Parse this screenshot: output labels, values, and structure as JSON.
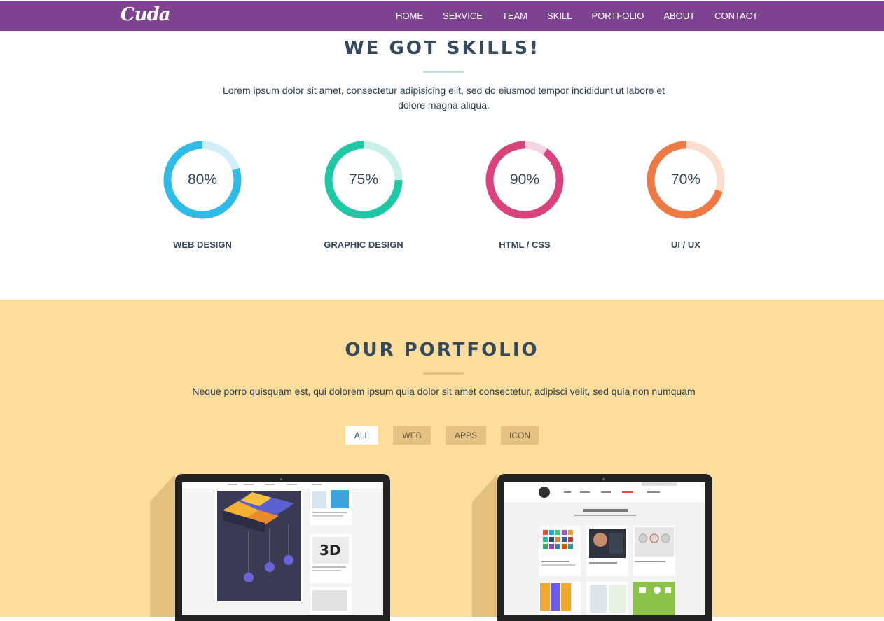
{
  "navbar": {
    "logo": "Cuda",
    "items": [
      "HOME",
      "SERVICE",
      "TEAM",
      "SKILL",
      "PORTFOLIO",
      "ABOUT",
      "CONTACT"
    ]
  },
  "skills": {
    "title": "WE GOT SKILLS!",
    "description": "Lorem ipsum dolor sit amet, consectetur adipisicing elit, sed do eiusmod tempor incididunt ut labore et dolore magna aliqua.",
    "items": [
      {
        "label": "WEB DESIGN",
        "value_text": "80%",
        "value": 80,
        "color": "#2fbbe7",
        "track": "#d2eef9"
      },
      {
        "label": "GRAPHIC DESIGN",
        "value_text": "75%",
        "value": 75,
        "color": "#1ec8a5",
        "track": "#c9f0e8"
      },
      {
        "label": "HTML / CSS",
        "value_text": "90%",
        "value": 90,
        "color": "#d9437c",
        "track": "#f6d3e1"
      },
      {
        "label": "UI / UX",
        "value_text": "70%",
        "value": 70,
        "color": "#ed7a44",
        "track": "#fbdece"
      }
    ]
  },
  "portfolio": {
    "title": "OUR PORTFOLIO",
    "description": "Neque porro quisquam est, qui dolorem ipsum quia dolor sit amet consectetur, adipisci velit, sed quia non numquam",
    "filters": [
      "ALL",
      "WEB",
      "APPS",
      "ICON"
    ],
    "active_filter": "ALL"
  },
  "colors": {
    "nav_bg": "#7d4391",
    "portfolio_bg": "#fddd9c",
    "skills_line": "#c8dce0",
    "portfolio_line": "#e5c283"
  }
}
